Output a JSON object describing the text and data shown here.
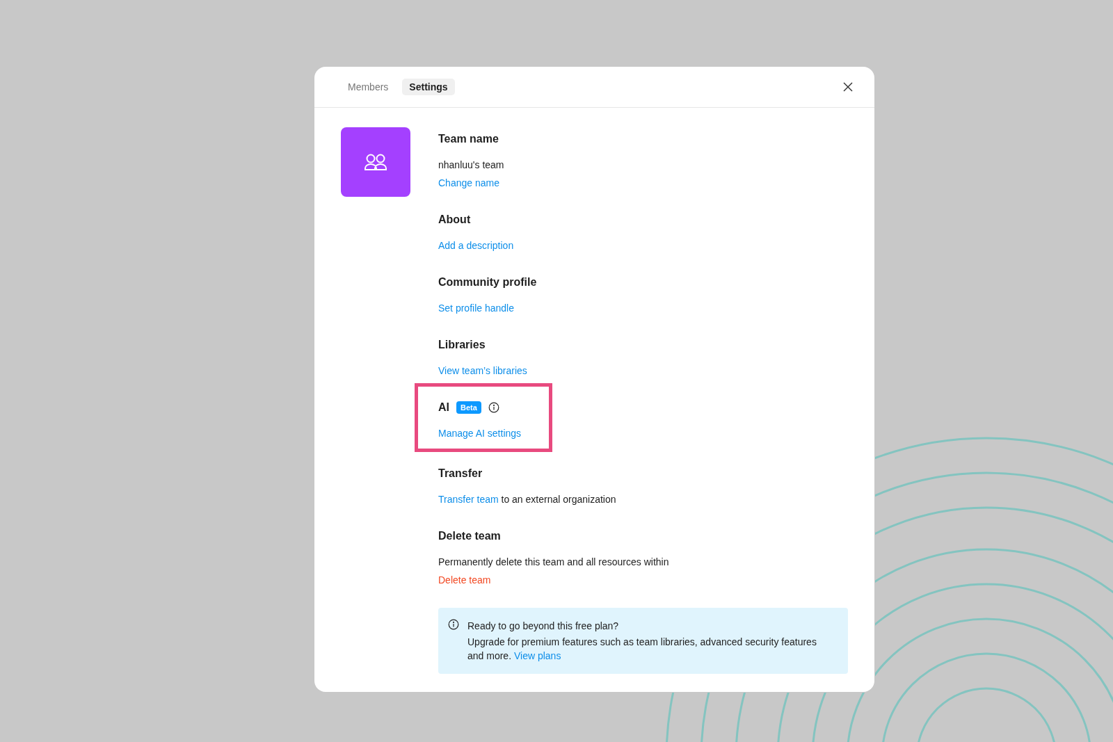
{
  "tabs": [
    {
      "label": "Members",
      "selected": false
    },
    {
      "label": "Settings",
      "selected": true
    }
  ],
  "sections": [
    {
      "title": "Team name",
      "highlighted": false,
      "lines": [
        {
          "kind": "text",
          "text": "nhanluu's team"
        },
        {
          "kind": "link",
          "text": "Change name"
        }
      ]
    },
    {
      "title": "About",
      "highlighted": false,
      "lines": [
        {
          "kind": "link",
          "text": "Add a description"
        }
      ]
    },
    {
      "title": "Community profile",
      "highlighted": false,
      "lines": [
        {
          "kind": "link",
          "text": "Set profile handle"
        }
      ]
    },
    {
      "title": "Libraries",
      "highlighted": false,
      "lines": [
        {
          "kind": "link",
          "text": "View team’s libraries"
        }
      ]
    },
    {
      "title": "AI",
      "badge": "Beta",
      "info": true,
      "highlighted": true,
      "lines": [
        {
          "kind": "link",
          "text": "Manage AI settings"
        }
      ]
    },
    {
      "title": "Transfer",
      "highlighted": false,
      "lines": [
        {
          "kind": "link_text",
          "text": "Transfer team",
          "rest": "to an external organization"
        }
      ]
    },
    {
      "title": "Delete team",
      "highlighted": false,
      "lines": [
        {
          "kind": "text",
          "text": "Permanently delete this team and all resources within"
        },
        {
          "kind": "danger",
          "text": "Delete team"
        }
      ]
    }
  ],
  "banner": {
    "title": "Ready to go beyond this free plan?",
    "body": "Upgrade for premium features such as team libraries, advanced security features and more.",
    "link": "View plans"
  }
}
